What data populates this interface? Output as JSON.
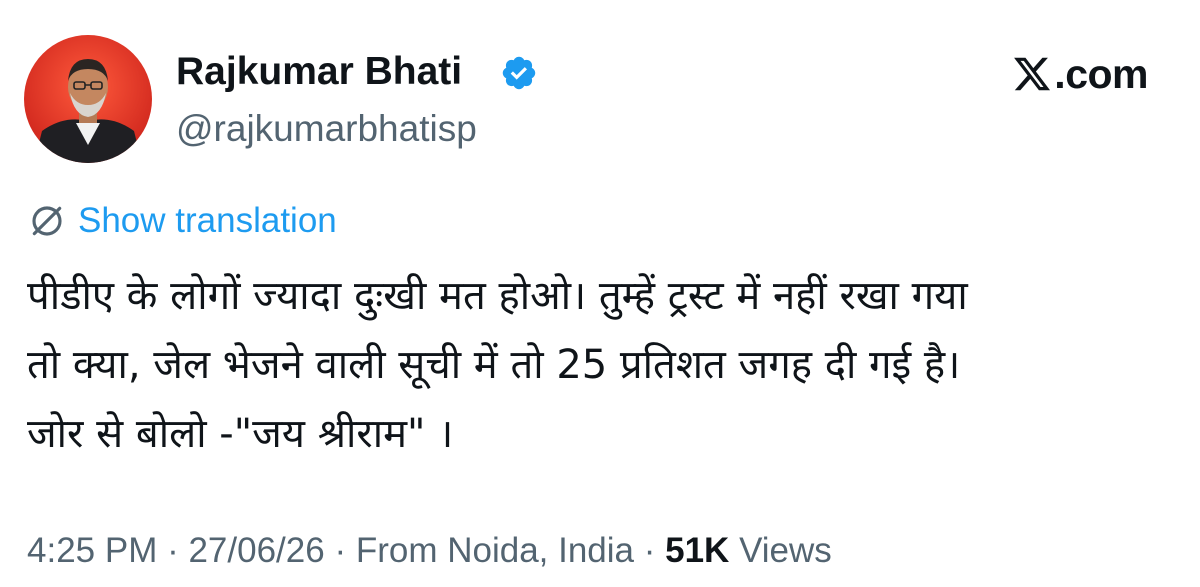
{
  "author": {
    "name": "Rajkumar Bhati",
    "handle": "@rajkumarbhatisp",
    "verified": true
  },
  "brand": {
    "label": ".com"
  },
  "translation": {
    "label": "Show translation"
  },
  "tweet": {
    "lines": [
      "पीडीए के लोगों ज्यादा दुःखी मत होओ। तुम्हें ट्रस्ट में नहीं रखा गया",
      "तो क्या, जेल भेजने वाली सूची में तो 25 प्रतिशत जगह दी गई है।",
      "जोर से बोलो -\"जय श्रीराम\" ।"
    ]
  },
  "meta": {
    "time": "4:25 PM",
    "date": "27/06/26",
    "location": "From Noida, India",
    "sep": " · ",
    "views_count": "51K",
    "views_label": "Views"
  },
  "icons": {
    "verified": "verified-badge-icon",
    "translate": "globe-icon",
    "brand": "x-logo-icon"
  },
  "colors": {
    "accent": "#1d9bf0",
    "text": "#0f1419",
    "muted": "#536471",
    "avatar_bg": "#d8261f"
  }
}
